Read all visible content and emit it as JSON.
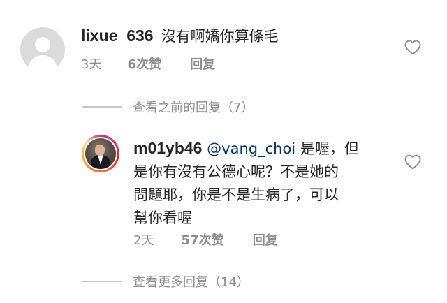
{
  "comments": [
    {
      "username": "lixue_636",
      "text": "沒有啊嬌你算條毛",
      "time": "3天",
      "likes": "6次赞",
      "reply_label": "回复"
    },
    {
      "username": "m01yb46",
      "mention": "@vang_choi",
      "text_line1": "是喔，但",
      "text_line2": "是你有沒有公德心呢？不是她的",
      "text_line3": "問題耶，你是不是生病了，可以",
      "text_line4": "幫你看喔",
      "time": "2天",
      "likes": "57次赞",
      "reply_label": "回复"
    }
  ],
  "view_previous": "查看之前的回复（7）",
  "view_more": "查看更多回复（14）",
  "icons": {
    "default_avatar": "default-user-avatar",
    "like": "heart-outline-icon"
  },
  "colors": {
    "text": "#262626",
    "secondary": "#8e8e8e",
    "mention": "#00376b",
    "divider": "#c7c7c7"
  }
}
